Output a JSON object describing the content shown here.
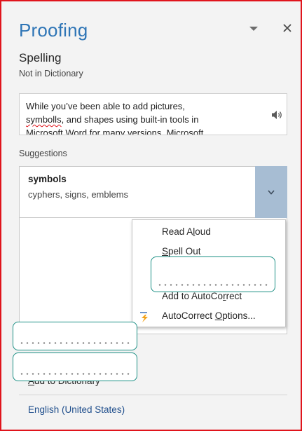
{
  "pane": {
    "title": "Proofing",
    "section_heading": "Spelling",
    "section_subtitle": "Not in Dictionary"
  },
  "context": {
    "line1": "While you’ve been able to add pictures,",
    "line2_error": "symbolls",
    "line2_rest": ", and shapes using built-in tools in",
    "line3": "Microsoft Word for many versions, Microsoft"
  },
  "suggestions": {
    "label": "Suggestions",
    "items": [
      {
        "word": "symbols",
        "synonyms": "cyphers, signs, emblems"
      }
    ]
  },
  "context_menu": {
    "read_aloud_pre": "Read A",
    "read_aloud_key": "l",
    "read_aloud_post": "oud",
    "spell_out_key": "S",
    "spell_out_rest": "pell Out",
    "add_autocorrect_pre": "Add to AutoCo",
    "add_autocorrect_key": "r",
    "add_autocorrect_post": "rect",
    "autocorrect_options_pre": "AutoCorrect ",
    "autocorrect_options_key": "O",
    "autocorrect_options_post": "ptions..."
  },
  "footer": {
    "add_dictionary_key": "A",
    "add_dictionary_rest": "dd to Dictionary",
    "language": "English (United States)"
  },
  "colors": {
    "title": "#2e75b6",
    "border_highlight": "#e0141c",
    "expand_button": "#a7bdd3",
    "callout_border": "#1a8f84",
    "language_link": "#1f4e8c"
  },
  "icons": {
    "dropdown": "chevron-down-icon",
    "close": "close-icon",
    "speaker": "speaker-icon",
    "expand": "chevron-down-icon",
    "autocorrect": "lightning-bolt-icon"
  }
}
